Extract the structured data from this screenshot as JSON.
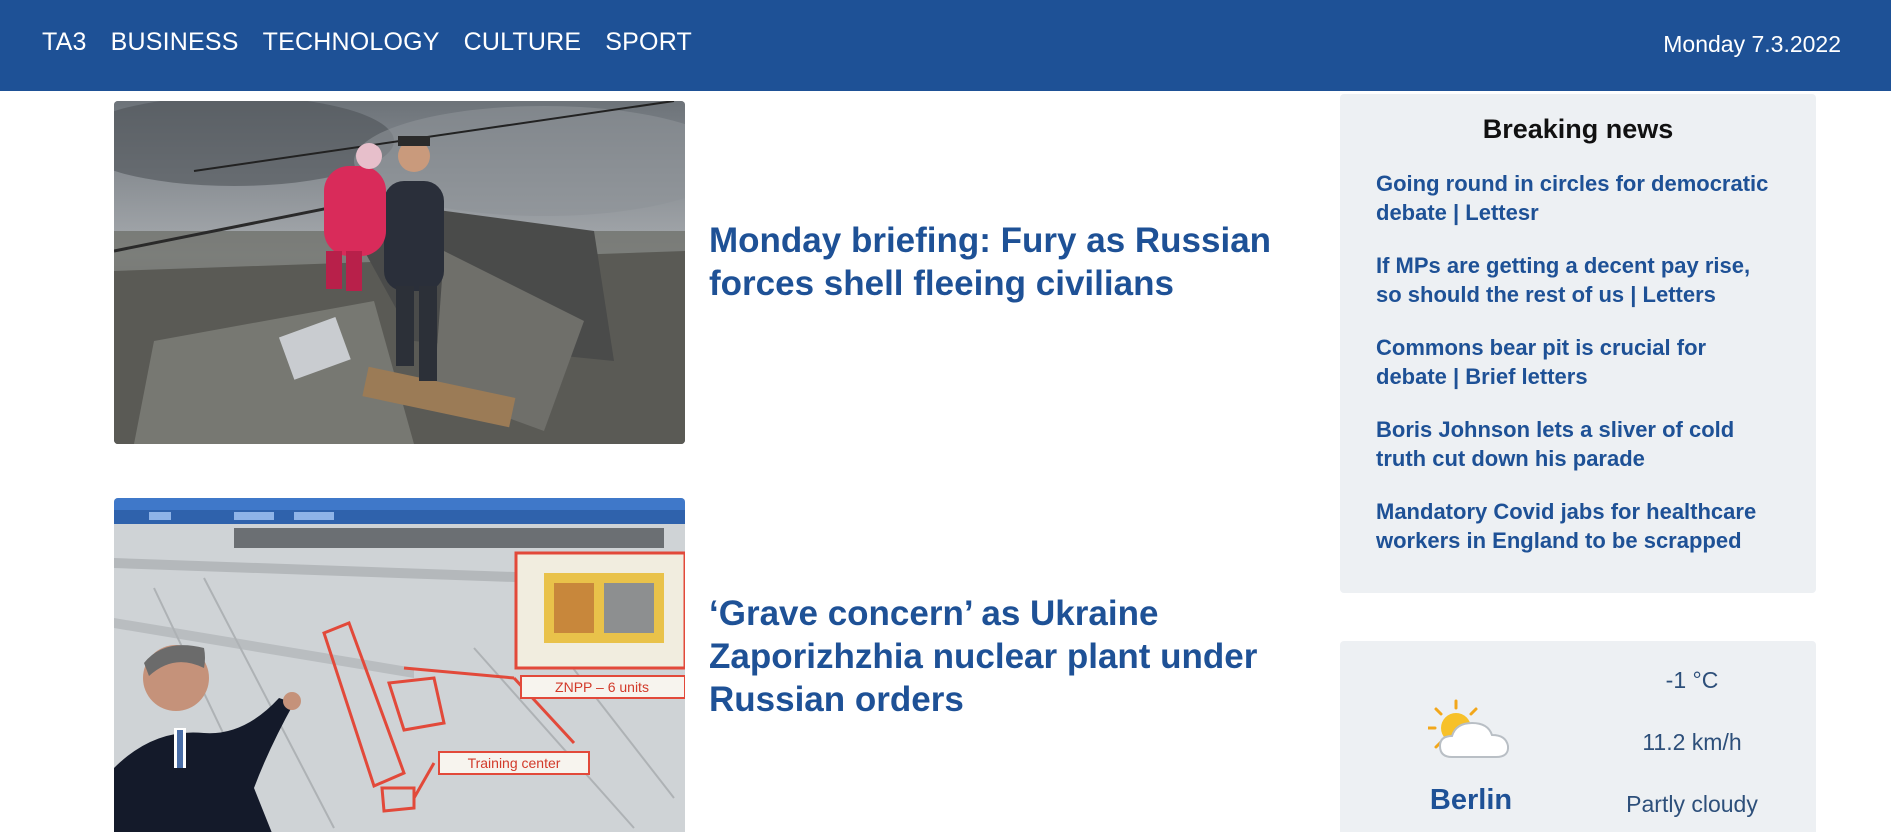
{
  "nav": {
    "items": [
      "TA3",
      "BUSINESS",
      "TECHNOLOGY",
      "CULTURE",
      "SPORT"
    ],
    "date": "Monday 7.3.2022"
  },
  "articles": [
    {
      "title": "Monday briefing: Fury as Russian forces shell fleeing civilians",
      "image": "man-carrying-child-over-destroyed-bridge-photo"
    },
    {
      "title": "‘Grave concern’ as Ukraine Zaporizhzhia nuclear plant under Russian orders",
      "image": "man-pointing-at-nuclear-plant-map-photo",
      "image_labels": [
        "ZNPP – 6 units",
        "Training center"
      ]
    }
  ],
  "breaking": {
    "heading": "Breaking news",
    "items": [
      "Going round in circles for democratic debate | Lettesr",
      "If MPs are getting a decent pay rise, so should the rest of us | Letters",
      "Commons bear pit is crucial for debate | Brief letters",
      "Boris Johnson lets a sliver of cold truth cut down his parade",
      "Mandatory Covid jabs for healthcare workers in England to be scrapped"
    ]
  },
  "weather": {
    "city": "Berlin",
    "temperature": "-1 °C",
    "wind": "11.2 km/h",
    "condition": "Partly cloudy",
    "icon": "partly-cloudy-icon"
  },
  "colors": {
    "brand": "#1e5196",
    "panel": "#edf0f3"
  }
}
